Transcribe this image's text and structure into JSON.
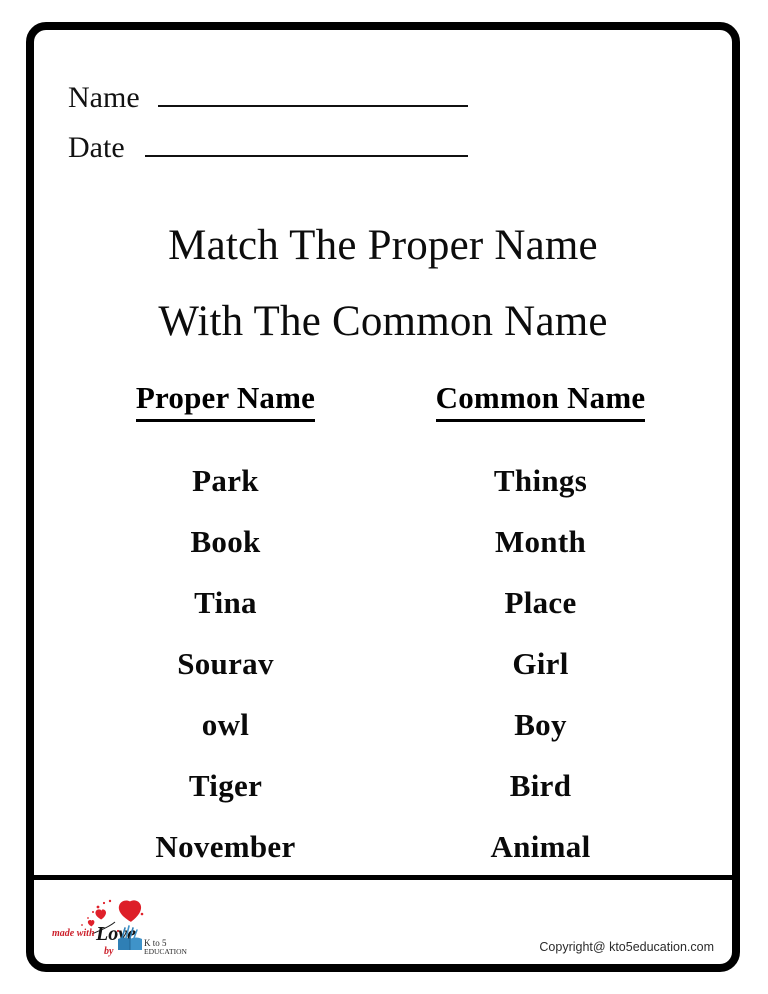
{
  "worksheet": {
    "fields": [
      {
        "label": "Name",
        "value": ""
      },
      {
        "label": "Date",
        "value": ""
      }
    ],
    "title": {
      "line1": "Match The Proper Name",
      "line2": "With The Common Name"
    },
    "columns": [
      {
        "header": "Proper Name",
        "words": [
          "Park",
          "Book",
          "Tina",
          "Sourav",
          "owl",
          "Tiger",
          "November"
        ]
      },
      {
        "header": "Common Name",
        "words": [
          "Things",
          "Month",
          "Place",
          "Girl",
          "Boy",
          "Bird",
          "Animal"
        ]
      }
    ],
    "footer": {
      "logo": {
        "made_with": "made with",
        "love": "Love",
        "by": "by",
        "brand_line1": "K to 5",
        "brand_line2": "EDUCATION",
        "heart_color": "#e0202a",
        "book_color": "#2f7fb5",
        "script_color": "#cc1f2a"
      },
      "copyright": "Copyright@ kto5education.com"
    }
  }
}
